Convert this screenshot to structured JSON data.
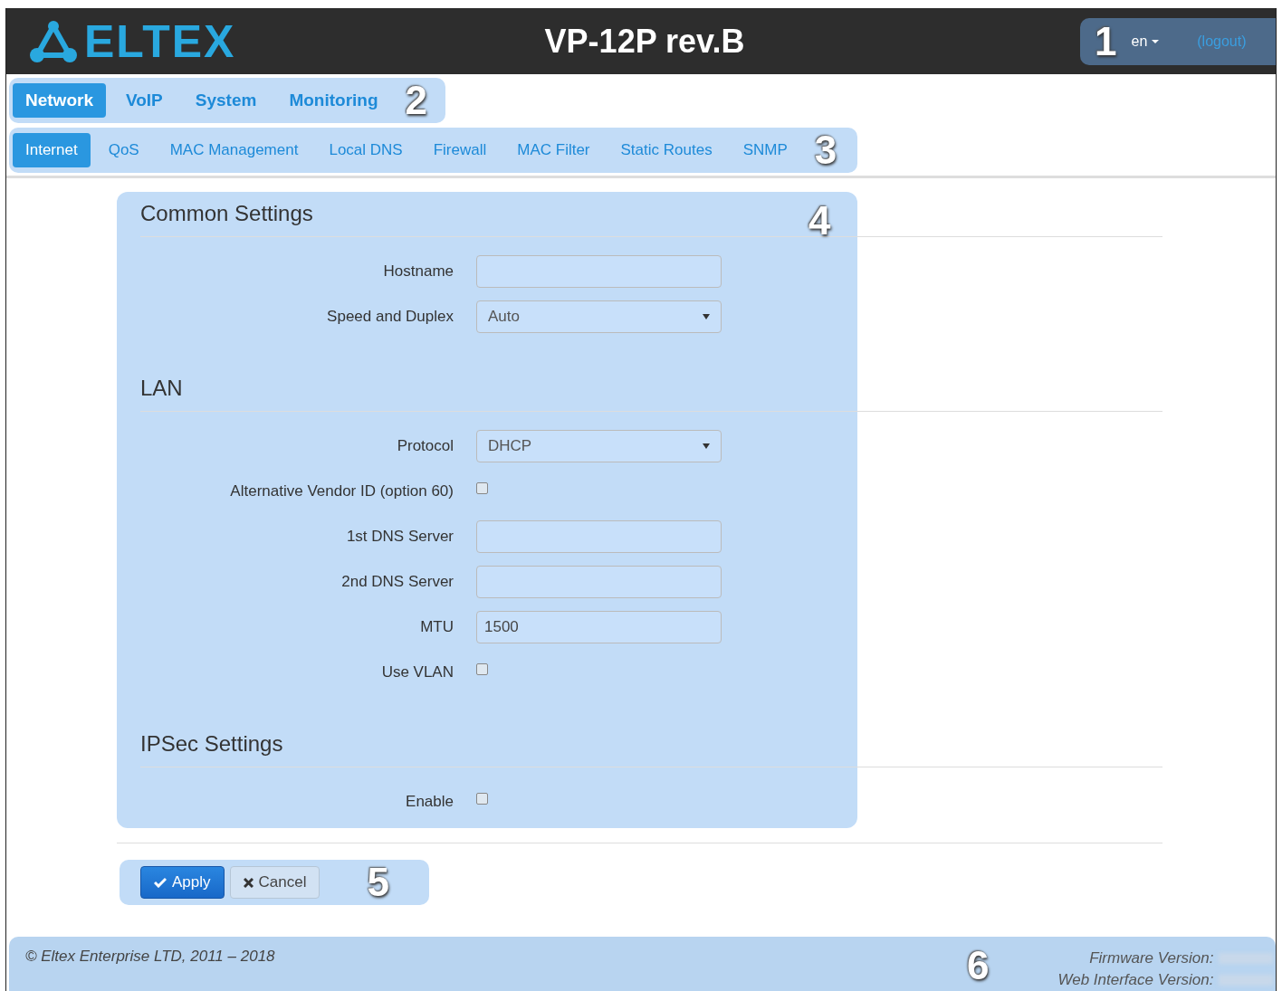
{
  "header": {
    "logo": "ELTEX",
    "title": "VP-12P rev.B",
    "callout": "1",
    "language": "en",
    "logout": "(logout)"
  },
  "main_menu": {
    "callout": "2",
    "items": [
      {
        "label": "Network",
        "selected": true
      },
      {
        "label": "VoIP",
        "selected": false
      },
      {
        "label": "System",
        "selected": false
      },
      {
        "label": "Monitoring",
        "selected": false
      }
    ]
  },
  "sub_menu": {
    "callout": "3",
    "items": [
      {
        "label": "Internet",
        "selected": true
      },
      {
        "label": "QoS",
        "selected": false
      },
      {
        "label": "MAC Management",
        "selected": false
      },
      {
        "label": "Local DNS",
        "selected": false
      },
      {
        "label": "Firewall",
        "selected": false
      },
      {
        "label": "MAC Filter",
        "selected": false
      },
      {
        "label": "Static Routes",
        "selected": false
      },
      {
        "label": "SNMP",
        "selected": false
      }
    ]
  },
  "form": {
    "callout": "4",
    "sections": [
      {
        "title": "Common Settings",
        "fields": [
          {
            "kind": "text",
            "label": "Hostname"
          },
          {
            "kind": "select",
            "label": "Speed and Duplex",
            "value": "Auto"
          }
        ]
      },
      {
        "title": "LAN",
        "fields": [
          {
            "kind": "select",
            "label": "Protocol",
            "value": "DHCP"
          },
          {
            "kind": "checkbox",
            "label": "Alternative Vendor ID (option 60)",
            "checked": false
          },
          {
            "kind": "text",
            "label": "1st DNS Server"
          },
          {
            "kind": "text",
            "label": "2nd DNS Server"
          },
          {
            "kind": "text",
            "label": "MTU",
            "value": "1500"
          },
          {
            "kind": "checkbox",
            "label": "Use VLAN",
            "checked": false
          }
        ]
      },
      {
        "title": "IPSec Settings",
        "fields": [
          {
            "kind": "checkbox",
            "label": "Enable",
            "checked": false
          }
        ]
      }
    ]
  },
  "actions": {
    "callout": "5",
    "buttons": [
      {
        "kind": "primary",
        "label": "Apply"
      },
      {
        "kind": "default",
        "label": "Cancel"
      }
    ]
  },
  "footer": {
    "callout": "6",
    "copyright": "© Eltex Enterprise LTD, 2011 – 2018",
    "versions": [
      "Firmware Version:",
      "Web Interface Version:"
    ]
  }
}
